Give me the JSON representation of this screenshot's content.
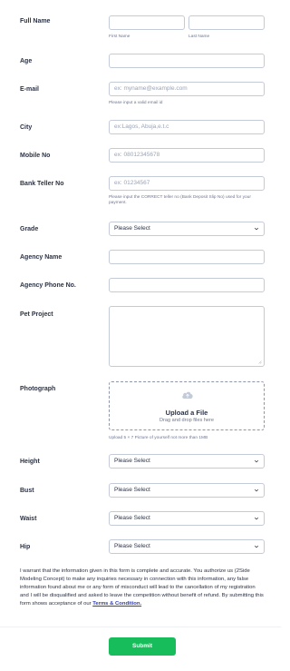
{
  "fields": {
    "full_name": {
      "label": "Full Name",
      "first_sub": "First Name",
      "last_sub": "Last Name"
    },
    "age": {
      "label": "Age"
    },
    "email": {
      "label": "E-mail",
      "placeholder": "ex: myname@example.com",
      "hint": "Please input a valid email id"
    },
    "city": {
      "label": "City",
      "placeholder": "ex:Lagos, Abuja,e.t.c"
    },
    "mobile": {
      "label": "Mobile No",
      "placeholder": "ex: 08012345678"
    },
    "bank_teller": {
      "label": "Bank Teller No",
      "placeholder": "ex: 01234567",
      "hint_line1": "Please input the CORRECT teller no (Bank Deposit Slip No) used for your",
      "hint_line2": "payment."
    },
    "grade": {
      "label": "Grade",
      "value": "Please Select"
    },
    "agency_name": {
      "label": "Agency Name"
    },
    "agency_phone": {
      "label": "Agency Phone No."
    },
    "pet_project": {
      "label": "Pet Project"
    },
    "photograph": {
      "label": "Photograph",
      "upload_title": "Upload a File",
      "upload_sub": "Drag and drop files here",
      "hint": "Upload 5 × 7 Picture of yourself not more than 1MB"
    },
    "height": {
      "label": "Height",
      "value": "Please Select"
    },
    "bust": {
      "label": "Bust",
      "value": "Please Select"
    },
    "waist": {
      "label": "Waist",
      "value": "Please Select"
    },
    "hip": {
      "label": "Hip",
      "value": "Please Select"
    }
  },
  "terms": {
    "text": "I warrant that the information given in this form is complete and accurate. You authorize us (2Side Modeling Concept) to make any inquiries necessary in connection with this information, any false information found about me or any form of misconduct will lead to the cancellation of my registration and I will be disqualified and asked to leave the competition without benefit of refund. By submitting this form shows acceptance of our ",
    "link": "Terms & Condition."
  },
  "submit_label": "Submit",
  "colors": {
    "submit": "#18bd5b",
    "link": "#2e3cb7",
    "border": "#c3cad8"
  }
}
